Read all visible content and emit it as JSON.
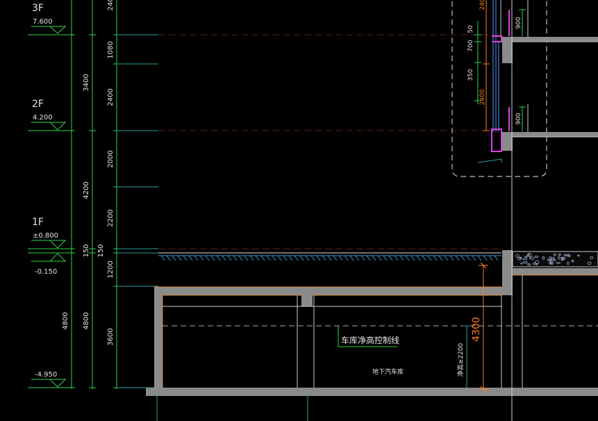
{
  "levels": {
    "f3": {
      "name": "3F",
      "elev": "7.600"
    },
    "f2": {
      "name": "2F",
      "elev": "4.200"
    },
    "f1": {
      "name": "1F",
      "elev": "±0.800",
      "elev_sub": "-0.150"
    },
    "b1": {
      "elev": "-4.950"
    }
  },
  "dims": {
    "storey_3": "3400",
    "storey_2": "4200",
    "base_total": "4800",
    "base_total_inner": "4800",
    "slab_150_a": "150",
    "slab_150_b": "150",
    "seg_top": "240",
    "seg_1080": "1080",
    "seg_2400": "2400",
    "seg_2000": "2000",
    "seg_2200": "2200",
    "seg_1200": "1200",
    "seg_3600": "3600"
  },
  "detail": {
    "d50": "50",
    "d700": "700",
    "d350": "350",
    "d2400": "2400",
    "d900_top": "900",
    "d900_bot": "900",
    "d240": "240"
  },
  "garage": {
    "control_line": "车库净高控制线",
    "label": "地下汽车库",
    "clear_height_note": "净高≥2200",
    "height_dim": "4300"
  },
  "colors": {
    "green": "#2bd64a",
    "cyan": "#3fb0b0",
    "gray_wall": "#8a8a8a",
    "orange": "#ff7a1a",
    "magenta": "#e040e0",
    "white": "#e6e6e6",
    "hatch": "#2f9fd0"
  }
}
